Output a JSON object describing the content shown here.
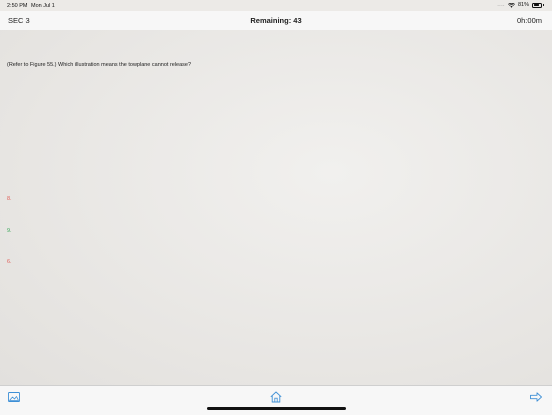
{
  "status": {
    "time": "2:50 PM",
    "date": "Mon Jul 1",
    "dots": "....",
    "battery_text": "81%",
    "battery_level": 0.81
  },
  "nav": {
    "section": "SEC 3",
    "remaining": "Remaining: 43",
    "timer": "0h:00m"
  },
  "question": {
    "text": "(Refer to Figure 55.) Which illustration means the towplane cannot release?"
  },
  "answers": [
    {
      "label": "8.",
      "color": "#e0605a"
    },
    {
      "label": "9.",
      "color": "#3aa65a"
    },
    {
      "label": "6.",
      "color": "#e0605a"
    }
  ],
  "tabbar": {
    "icons": [
      "image-icon",
      "home-icon",
      "arrow-right-icon"
    ],
    "accent": "#3d8fd6"
  }
}
